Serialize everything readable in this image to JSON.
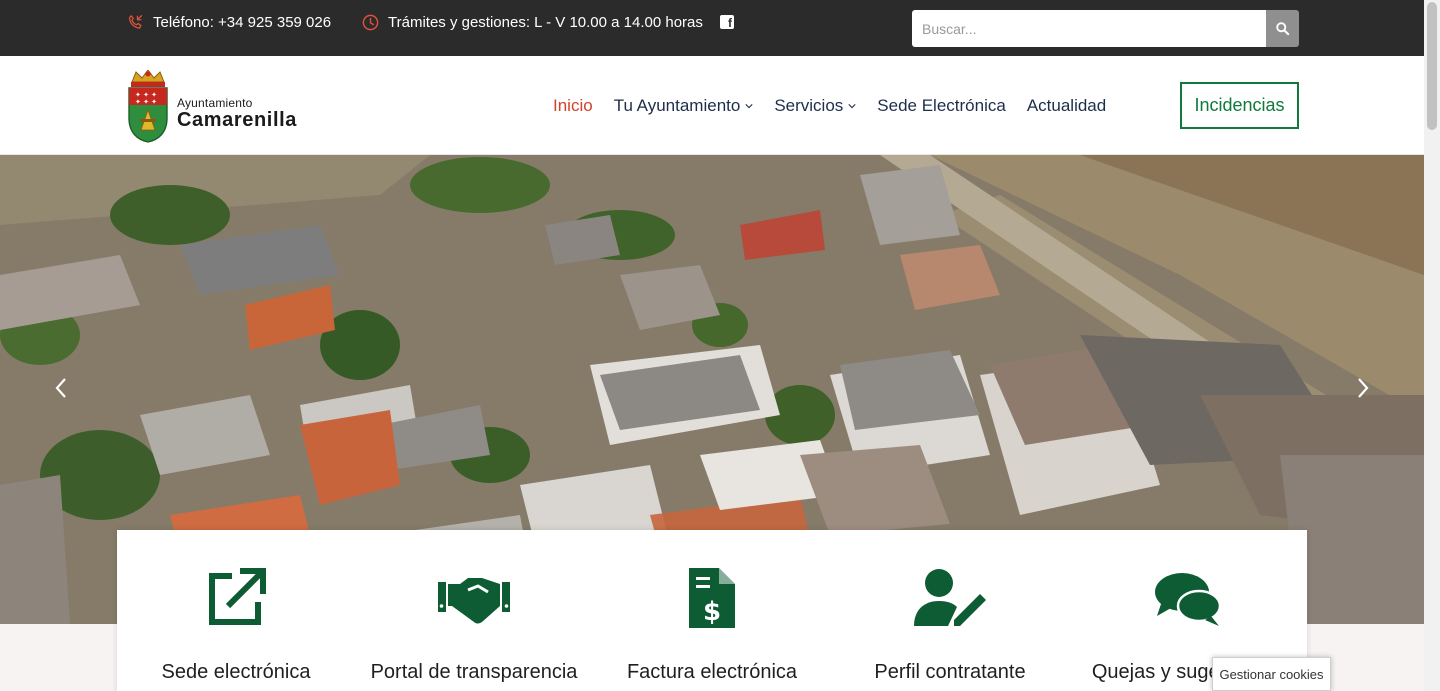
{
  "topbar": {
    "phone_text": "Teléfono: +34 925 359 026",
    "phone_icon": "phone-icon",
    "hours_text": "Trámites y gestiones: L - V 10.00 a 14.00 horas",
    "hours_icon": "clock-icon",
    "social_icon": "facebook-icon",
    "search": {
      "placeholder": "Buscar...",
      "value": "",
      "icon": "search-icon"
    }
  },
  "header": {
    "logo": {
      "line1": "Ayuntamiento",
      "line2": "Camarenilla",
      "icon": "coat-of-arms-icon"
    },
    "nav": [
      {
        "label": "Inicio",
        "active": true
      },
      {
        "label": "Tu Ayuntamiento",
        "dropdown": true
      },
      {
        "label": "Servicios",
        "dropdown": true
      },
      {
        "label": "Sede Electrónica"
      },
      {
        "label": "Actualidad"
      }
    ],
    "cta_label": "Incidencias"
  },
  "hero": {
    "image": "aerial-village-photo",
    "prev_icon": "chevron-left-icon",
    "next_icon": "chevron-right-icon"
  },
  "quick_links": [
    {
      "label": "Sede electrónica",
      "icon": "external-link-icon"
    },
    {
      "label": "Portal de transparencia",
      "icon": "handshake-icon"
    },
    {
      "label": "Factura electrónica",
      "icon": "invoice-dollar-icon"
    },
    {
      "label": "Perfil contratante",
      "icon": "user-edit-icon"
    },
    {
      "label": "Quejas y sugerencias",
      "icon": "comments-icon"
    }
  ],
  "cookies": {
    "label": "Gestionar cookies"
  },
  "colors": {
    "topbar": "#2b2b2b",
    "accent_green": "#0f7a3c",
    "icon_green": "#0d5c33",
    "active_nav": "#d4412b",
    "nav_text": "#1d2e4a",
    "topbar_icon": "#e0533a"
  }
}
